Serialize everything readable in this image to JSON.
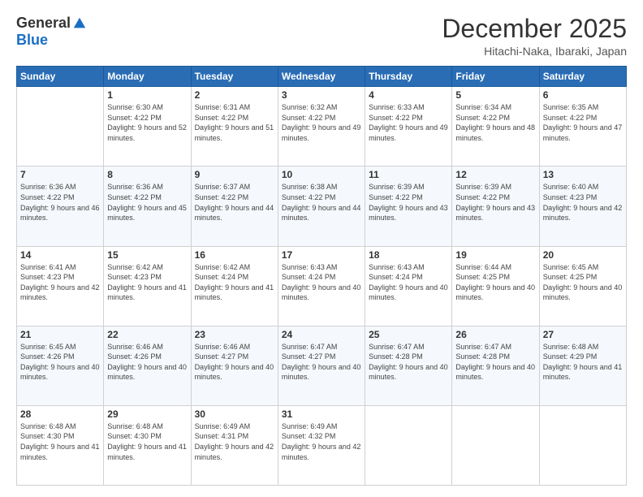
{
  "logo": {
    "general": "General",
    "blue": "Blue"
  },
  "header": {
    "month": "December 2025",
    "location": "Hitachi-Naka, Ibaraki, Japan"
  },
  "weekdays": [
    "Sunday",
    "Monday",
    "Tuesday",
    "Wednesday",
    "Thursday",
    "Friday",
    "Saturday"
  ],
  "weeks": [
    [
      {
        "day": "",
        "sunrise": "",
        "sunset": "",
        "daylight": ""
      },
      {
        "day": "1",
        "sunrise": "Sunrise: 6:30 AM",
        "sunset": "Sunset: 4:22 PM",
        "daylight": "Daylight: 9 hours and 52 minutes."
      },
      {
        "day": "2",
        "sunrise": "Sunrise: 6:31 AM",
        "sunset": "Sunset: 4:22 PM",
        "daylight": "Daylight: 9 hours and 51 minutes."
      },
      {
        "day": "3",
        "sunrise": "Sunrise: 6:32 AM",
        "sunset": "Sunset: 4:22 PM",
        "daylight": "Daylight: 9 hours and 49 minutes."
      },
      {
        "day": "4",
        "sunrise": "Sunrise: 6:33 AM",
        "sunset": "Sunset: 4:22 PM",
        "daylight": "Daylight: 9 hours and 49 minutes."
      },
      {
        "day": "5",
        "sunrise": "Sunrise: 6:34 AM",
        "sunset": "Sunset: 4:22 PM",
        "daylight": "Daylight: 9 hours and 48 minutes."
      },
      {
        "day": "6",
        "sunrise": "Sunrise: 6:35 AM",
        "sunset": "Sunset: 4:22 PM",
        "daylight": "Daylight: 9 hours and 47 minutes."
      }
    ],
    [
      {
        "day": "7",
        "sunrise": "Sunrise: 6:36 AM",
        "sunset": "Sunset: 4:22 PM",
        "daylight": "Daylight: 9 hours and 46 minutes."
      },
      {
        "day": "8",
        "sunrise": "Sunrise: 6:36 AM",
        "sunset": "Sunset: 4:22 PM",
        "daylight": "Daylight: 9 hours and 45 minutes."
      },
      {
        "day": "9",
        "sunrise": "Sunrise: 6:37 AM",
        "sunset": "Sunset: 4:22 PM",
        "daylight": "Daylight: 9 hours and 44 minutes."
      },
      {
        "day": "10",
        "sunrise": "Sunrise: 6:38 AM",
        "sunset": "Sunset: 4:22 PM",
        "daylight": "Daylight: 9 hours and 44 minutes."
      },
      {
        "day": "11",
        "sunrise": "Sunrise: 6:39 AM",
        "sunset": "Sunset: 4:22 PM",
        "daylight": "Daylight: 9 hours and 43 minutes."
      },
      {
        "day": "12",
        "sunrise": "Sunrise: 6:39 AM",
        "sunset": "Sunset: 4:22 PM",
        "daylight": "Daylight: 9 hours and 43 minutes."
      },
      {
        "day": "13",
        "sunrise": "Sunrise: 6:40 AM",
        "sunset": "Sunset: 4:23 PM",
        "daylight": "Daylight: 9 hours and 42 minutes."
      }
    ],
    [
      {
        "day": "14",
        "sunrise": "Sunrise: 6:41 AM",
        "sunset": "Sunset: 4:23 PM",
        "daylight": "Daylight: 9 hours and 42 minutes."
      },
      {
        "day": "15",
        "sunrise": "Sunrise: 6:42 AM",
        "sunset": "Sunset: 4:23 PM",
        "daylight": "Daylight: 9 hours and 41 minutes."
      },
      {
        "day": "16",
        "sunrise": "Sunrise: 6:42 AM",
        "sunset": "Sunset: 4:24 PM",
        "daylight": "Daylight: 9 hours and 41 minutes."
      },
      {
        "day": "17",
        "sunrise": "Sunrise: 6:43 AM",
        "sunset": "Sunset: 4:24 PM",
        "daylight": "Daylight: 9 hours and 40 minutes."
      },
      {
        "day": "18",
        "sunrise": "Sunrise: 6:43 AM",
        "sunset": "Sunset: 4:24 PM",
        "daylight": "Daylight: 9 hours and 40 minutes."
      },
      {
        "day": "19",
        "sunrise": "Sunrise: 6:44 AM",
        "sunset": "Sunset: 4:25 PM",
        "daylight": "Daylight: 9 hours and 40 minutes."
      },
      {
        "day": "20",
        "sunrise": "Sunrise: 6:45 AM",
        "sunset": "Sunset: 4:25 PM",
        "daylight": "Daylight: 9 hours and 40 minutes."
      }
    ],
    [
      {
        "day": "21",
        "sunrise": "Sunrise: 6:45 AM",
        "sunset": "Sunset: 4:26 PM",
        "daylight": "Daylight: 9 hours and 40 minutes."
      },
      {
        "day": "22",
        "sunrise": "Sunrise: 6:46 AM",
        "sunset": "Sunset: 4:26 PM",
        "daylight": "Daylight: 9 hours and 40 minutes."
      },
      {
        "day": "23",
        "sunrise": "Sunrise: 6:46 AM",
        "sunset": "Sunset: 4:27 PM",
        "daylight": "Daylight: 9 hours and 40 minutes."
      },
      {
        "day": "24",
        "sunrise": "Sunrise: 6:47 AM",
        "sunset": "Sunset: 4:27 PM",
        "daylight": "Daylight: 9 hours and 40 minutes."
      },
      {
        "day": "25",
        "sunrise": "Sunrise: 6:47 AM",
        "sunset": "Sunset: 4:28 PM",
        "daylight": "Daylight: 9 hours and 40 minutes."
      },
      {
        "day": "26",
        "sunrise": "Sunrise: 6:47 AM",
        "sunset": "Sunset: 4:28 PM",
        "daylight": "Daylight: 9 hours and 40 minutes."
      },
      {
        "day": "27",
        "sunrise": "Sunrise: 6:48 AM",
        "sunset": "Sunset: 4:29 PM",
        "daylight": "Daylight: 9 hours and 41 minutes."
      }
    ],
    [
      {
        "day": "28",
        "sunrise": "Sunrise: 6:48 AM",
        "sunset": "Sunset: 4:30 PM",
        "daylight": "Daylight: 9 hours and 41 minutes."
      },
      {
        "day": "29",
        "sunrise": "Sunrise: 6:48 AM",
        "sunset": "Sunset: 4:30 PM",
        "daylight": "Daylight: 9 hours and 41 minutes."
      },
      {
        "day": "30",
        "sunrise": "Sunrise: 6:49 AM",
        "sunset": "Sunset: 4:31 PM",
        "daylight": "Daylight: 9 hours and 42 minutes."
      },
      {
        "day": "31",
        "sunrise": "Sunrise: 6:49 AM",
        "sunset": "Sunset: 4:32 PM",
        "daylight": "Daylight: 9 hours and 42 minutes."
      },
      {
        "day": "",
        "sunrise": "",
        "sunset": "",
        "daylight": ""
      },
      {
        "day": "",
        "sunrise": "",
        "sunset": "",
        "daylight": ""
      },
      {
        "day": "",
        "sunrise": "",
        "sunset": "",
        "daylight": ""
      }
    ]
  ]
}
